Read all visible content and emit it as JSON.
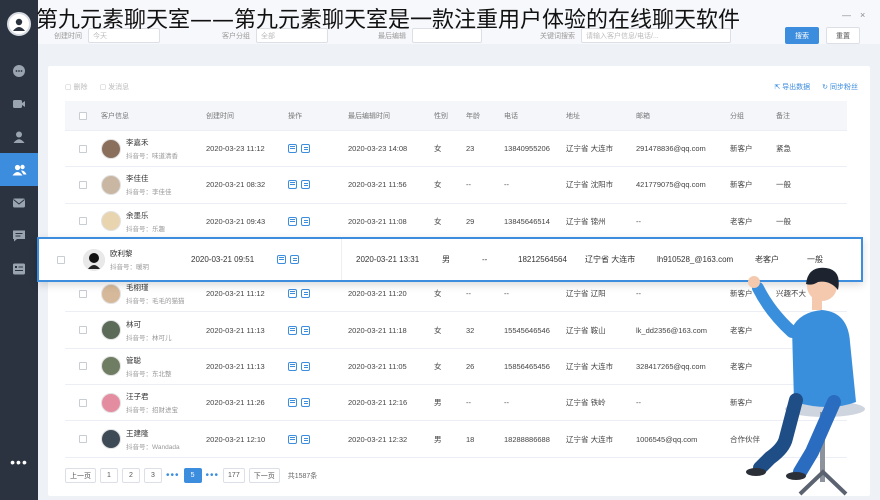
{
  "overlay_title": "第九元素聊天室——第九元素聊天室是一款注重用户体验的在线聊天软件",
  "window": {
    "minimize": "—",
    "close": "×"
  },
  "filters": {
    "created_time": {
      "label": "创建时间",
      "value": "今天"
    },
    "customer_group": {
      "label": "客户分组",
      "value": "全部"
    },
    "last_edited": {
      "label": "最后编辑",
      "value": ""
    },
    "gender": {
      "label": "性别",
      "value": "全部"
    },
    "keyword": {
      "label": "关键词搜索",
      "placeholder": "请输入客户信息/电话/..."
    }
  },
  "search_btn": "搜索",
  "reset_btn": "重置",
  "toolbar": {
    "delete": "删除",
    "send_message": "发消息",
    "export": "导出数据",
    "sync_fans": "同步粉丝"
  },
  "table": {
    "headers": {
      "info": "客户信息",
      "created": "创建时间",
      "ops": "操作",
      "edited": "最后编辑时间",
      "gender": "性别",
      "age": "年龄",
      "phone": "电话",
      "addr": "地址",
      "email": "邮箱",
      "group": "分组",
      "note": "备注"
    },
    "rows": [
      {
        "name": "李嘉禾",
        "handle": "抖音号：味道清香",
        "created": "2020-03-23 11:12",
        "edited": "2020-03-23 14:08",
        "gender": "女",
        "age": "23",
        "phone": "13840955206",
        "addr": "辽宁省 大连市",
        "email": "291478836@qq.com",
        "group": "新客户",
        "note": "紧急"
      },
      {
        "name": "李佳佳",
        "handle": "抖音号：李佳佳",
        "created": "2020-03-21 08:32",
        "edited": "2020-03-21 11:56",
        "gender": "女",
        "age": "--",
        "phone": "--",
        "addr": "辽宁省 沈阳市",
        "email": "421779075@qq.com",
        "group": "新客户",
        "note": "一般"
      },
      {
        "name": "余墨乐",
        "handle": "抖音号：乐趣",
        "created": "2020-03-21 09:43",
        "edited": "2020-03-21 11:08",
        "gender": "女",
        "age": "29",
        "phone": "13845646514",
        "addr": "辽宁省 锦州",
        "email": "--",
        "group": "老客户",
        "note": "一般"
      },
      {
        "name": "欧利黎",
        "handle": "抖音号：暖玥",
        "created": "2020-03-21 09:51",
        "edited": "2020-03-21 13:31",
        "gender": "男",
        "age": "--",
        "phone": "18212564564",
        "addr": "辽宁省 大连市",
        "email": "lh910528_@163.com",
        "group": "老客户",
        "note": "一般"
      },
      {
        "name": "毛栩瑾",
        "handle": "抖音号：毛毛的猫猫",
        "created": "2020-03-21 11:12",
        "edited": "2020-03-21 11:20",
        "gender": "女",
        "age": "--",
        "phone": "--",
        "addr": "辽宁省 辽阳",
        "email": "--",
        "group": "新客户",
        "note": "兴趣不大"
      },
      {
        "name": "林可",
        "handle": "抖音号：林可儿",
        "created": "2020-03-21 11:13",
        "edited": "2020-03-21 11:18",
        "gender": "女",
        "age": "32",
        "phone": "15545646546",
        "addr": "辽宁省 鞍山",
        "email": "lk_dd2356@163.com",
        "group": "老客户",
        "note": ""
      },
      {
        "name": "管聪",
        "handle": "抖音号：东北整",
        "created": "2020-03-21 11:13",
        "edited": "2020-03-21 11:05",
        "gender": "女",
        "age": "26",
        "phone": "15856465456",
        "addr": "辽宁省 大连市",
        "email": "328417265@qq.com",
        "group": "老客户",
        "note": ""
      },
      {
        "name": "汪子君",
        "handle": "抖音号：招财进宝",
        "created": "2020-03-21 11:26",
        "edited": "2020-03-21 12:16",
        "gender": "男",
        "age": "--",
        "phone": "--",
        "addr": "辽宁省 铁岭",
        "email": "--",
        "group": "新客户",
        "note": ""
      },
      {
        "name": "王建隆",
        "handle": "抖音号：Wandada",
        "created": "2020-03-21 12:10",
        "edited": "2020-03-21 12:32",
        "gender": "男",
        "age": "18",
        "phone": "18288886688",
        "addr": "辽宁省 大连市",
        "email": "1006545@qq.com",
        "group": "合作伙伴",
        "note": ""
      }
    ]
  },
  "pagination": {
    "prev": "上一页",
    "pages": [
      "1",
      "2",
      "3"
    ],
    "dots": "•••",
    "current": "5",
    "last": "177",
    "next": "下一页",
    "total": "共1587条"
  },
  "colors": {
    "accent": "#3c8dde",
    "sidebar": "#2b3340",
    "figure_shirt": "#3a8fdc"
  },
  "icons": [
    "user-avatar-icon",
    "chat-icon",
    "video-icon",
    "user-icon",
    "group-icon",
    "mail-icon",
    "message-icon",
    "dashboard-icon",
    "more-icon"
  ]
}
